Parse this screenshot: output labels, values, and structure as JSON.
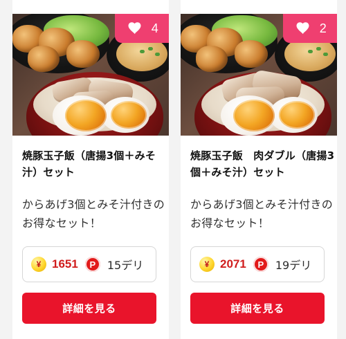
{
  "colors": {
    "page_background": "#f3f3f3",
    "card_background": "#ffffff",
    "like_badge": "#ef3f70",
    "price_red": "#d01d1d",
    "button_red": "#e9142b"
  },
  "cards": [
    {
      "likes": "4",
      "title": "焼豚玉子飯（唐揚3個＋みそ汁）セット",
      "description": "からあげ3個とみそ汁付きのお得なセット！",
      "coin_symbol": "¥",
      "price": "1651",
      "point_symbol": "P",
      "points": "15デリ",
      "button_label": "詳細を見る",
      "icons": {
        "like": "heart-icon",
        "coin": "yen-coin-icon",
        "point": "point-icon"
      }
    },
    {
      "likes": "2",
      "title": "焼豚玉子飯　肉ダブル（唐揚3個＋みそ汁）セット",
      "description": "からあげ3個とみそ汁付きのお得なセット！",
      "coin_symbol": "¥",
      "price": "2071",
      "point_symbol": "P",
      "points": "19デリ",
      "button_label": "詳細を見る",
      "icons": {
        "like": "heart-icon",
        "coin": "yen-coin-icon",
        "point": "point-icon"
      }
    }
  ]
}
